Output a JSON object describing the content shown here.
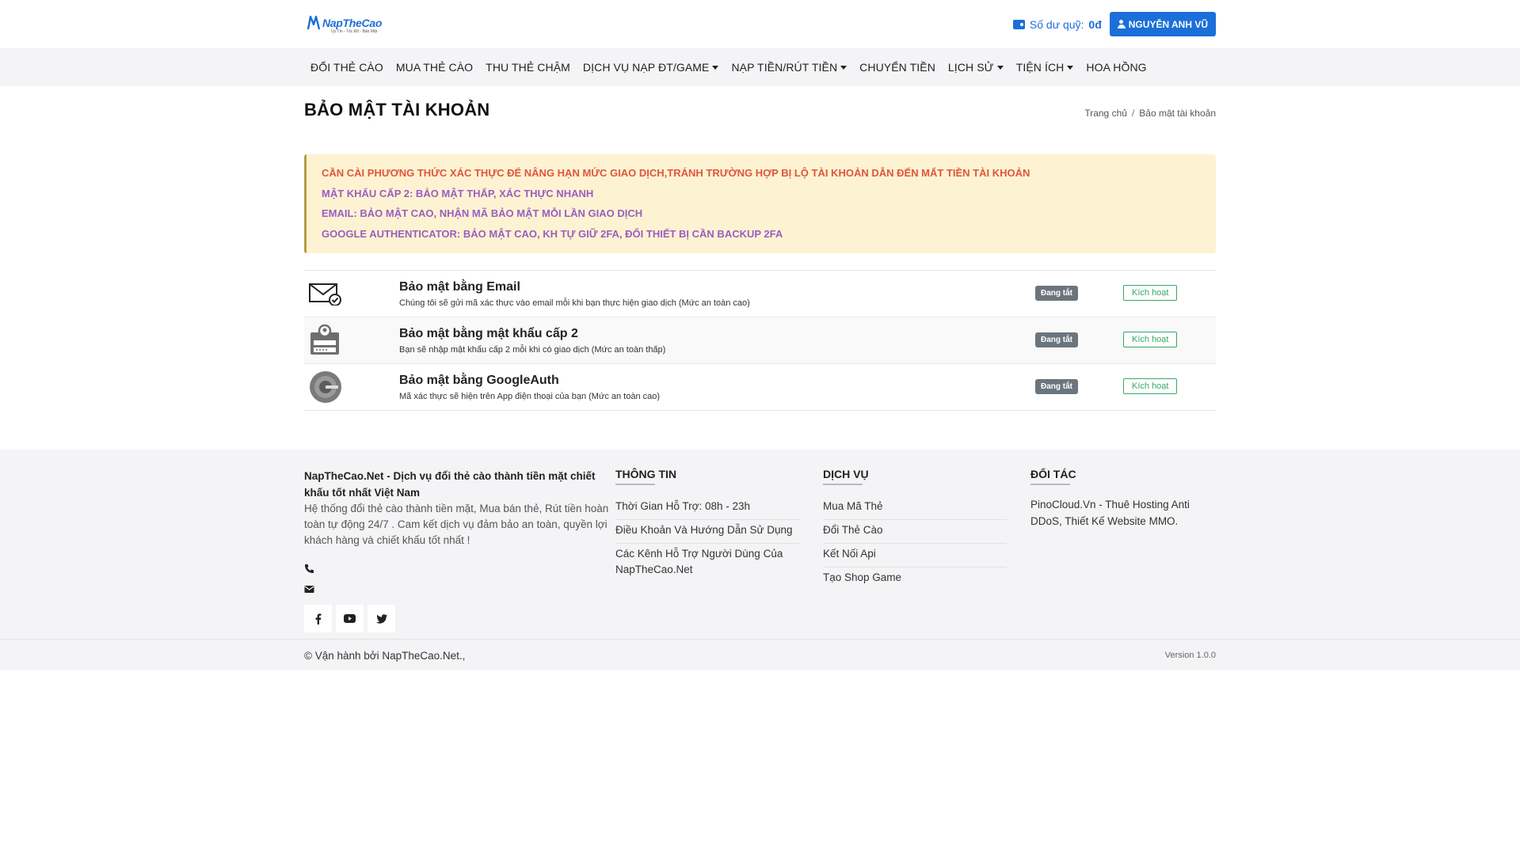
{
  "header": {
    "logo_text": "NapTheCao",
    "logo_tagline": "Uy Tín - Tốc Độ - Bảo Mật",
    "balance_label": "Số dư quỹ:",
    "balance_value": "0đ",
    "user_name": "NGUYỄN ANH VŨ"
  },
  "nav": {
    "items": [
      {
        "label": "ĐỔI THẺ CÀO",
        "dropdown": false
      },
      {
        "label": "MUA THẺ CÀO",
        "dropdown": false
      },
      {
        "label": "THU THẺ CHẬM",
        "dropdown": false
      },
      {
        "label": "DỊCH VỤ NẠP ĐT/GAME",
        "dropdown": true
      },
      {
        "label": "NẠP TIỀN/RÚT TIỀN",
        "dropdown": true
      },
      {
        "label": "CHUYỂN TIỀN",
        "dropdown": false
      },
      {
        "label": "LỊCH SỬ",
        "dropdown": true
      },
      {
        "label": "TIỆN ÍCH",
        "dropdown": true
      },
      {
        "label": "HOA HỒNG",
        "dropdown": false
      }
    ]
  },
  "page": {
    "title": "BẢO MẬT TÀI KHOẢN",
    "breadcrumb": [
      "Trang chủ",
      "/",
      "Bảo mật tài khoản"
    ]
  },
  "warning": {
    "lines": [
      "CẦN CÀI PHƯƠNG THỨC XÁC THỰC ĐỂ NÂNG HẠN MỨC GIAO DỊCH,TRÁNH TRƯỜNG HỢP BỊ LỘ TÀI KHOẢN DẪN ĐẾN MẤT TIỀN TÀI KHOẢN",
      "MẬT KHẨU CẤP 2: BẢO MẬT THẤP, XÁC THỰC NHANH",
      "EMAIL: BẢO MẬT CAO, NHẬN MÃ BẢO MẬT MỖI LẦN GIAO DỊCH",
      "GOOGLE AUTHENTICATOR: BẢO MẬT CAO, KH TỰ GIỮ 2FA, ĐỔI THIẾT BỊ CẦN BACKUP 2FA"
    ],
    "colors": {
      "red": "#e0563b",
      "purple": "#9b5ec2",
      "background": "#fdf3d2"
    }
  },
  "security_methods": [
    {
      "icon": "envelope-check-icon",
      "title": "Bảo mật bằng Email",
      "description": "Chúng tôi sẽ gửi mã xác thực vào email mỗi khi bạn thực hiện giao dịch (Mức an toàn cao)",
      "status": "Đang tắt",
      "action": "Kích hoạt"
    },
    {
      "icon": "password-card-icon",
      "title": "Bảo mật bằng mật khẩu cấp 2",
      "description": "Bạn sẽ nhập mật khẩu cấp 2 mỗi khi có giao dịch (Mức an toàn thấp)",
      "status": "Đang tắt",
      "action": "Kích hoạt"
    },
    {
      "icon": "google-authenticator-icon",
      "title": "Bảo mật bằng GoogleAuth",
      "description": "Mã xác thực sẽ hiện trên App điện thoại của bạn (Mức an toàn cao)",
      "status": "Đang tắt",
      "action": "Kích hoạt"
    }
  ],
  "footer": {
    "brand": "NapTheCao.Net - Dịch vụ đổi thẻ cào thành tiền mặt chiết khấu tốt nhất Việt Nam",
    "about": "Hệ thống đổi thẻ cào thành tiền mặt, Mua bán thẻ, Rút tiền hoàn toàn tự động 24/7 . Cam kết dịch vụ đảm bảo an toàn, quyền lợi khách hàng và chiết khấu tốt nhất !",
    "socials": [
      "facebook-icon",
      "youtube-icon",
      "twitter-icon"
    ],
    "info": {
      "heading": "THÔNG TIN",
      "links": [
        "Thời Gian Hỗ Trợ: 08h - 23h",
        "Điều Khoản Và Hướng Dẫn Sử Dụng",
        "Các Kênh Hỗ Trợ Người Dùng Của NapTheCao.Net"
      ]
    },
    "services": {
      "heading": "DỊCH VỤ",
      "links": [
        "Mua Mã Thẻ",
        "Đổi Thẻ Cào",
        "Kết Nối Api",
        "Tạo Shop Game"
      ]
    },
    "partners": {
      "heading": "ĐỐI TÁC",
      "text": "PinoCloud.Vn - Thuê Hosting Anti DDoS, Thiết Kế Website MMO."
    },
    "copyright": "© Vận hành bởi NapTheCao.Net.,",
    "version": "Version 1.0.0"
  }
}
